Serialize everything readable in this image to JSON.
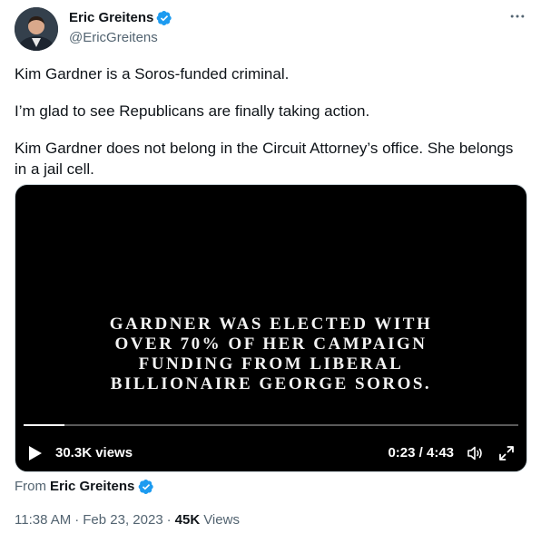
{
  "author": {
    "display_name": "Eric Greitens",
    "handle": "@EricGreitens",
    "verified_icon": "verified-badge-icon"
  },
  "more_icon": "more-options-icon",
  "tweet": {
    "paragraphs": [
      "Kim Gardner is a Soros-funded criminal.",
      "I’m glad to see Republicans are finally taking action.",
      "Kim Gardner does not belong in the Circuit Attorney’s office. She belongs in a jail cell."
    ]
  },
  "video": {
    "caption_lines": [
      "GARDNER WAS ELECTED WITH",
      "OVER 70% OF HER CAMPAIGN",
      "FUNDING FROM LIBERAL",
      "BILLIONAIRE GEORGE SOROS."
    ],
    "progress_fraction": 0.082,
    "views": "30.3K views",
    "time": "0:23 / 4:43",
    "play_icon": "play-icon",
    "volume_icon": "volume-icon",
    "fullscreen_icon": "fullscreen-icon"
  },
  "source": {
    "prefix": "From",
    "name": "Eric Greitens"
  },
  "meta": {
    "time": "11:38 AM",
    "separator": "·",
    "date": "Feb 23, 2023",
    "views_count": "45K",
    "views_label": "Views"
  },
  "colors": {
    "text_primary": "#0f1419",
    "text_secondary": "#536471",
    "verified_blue": "#1d9bf0",
    "video_bg": "#000000"
  }
}
